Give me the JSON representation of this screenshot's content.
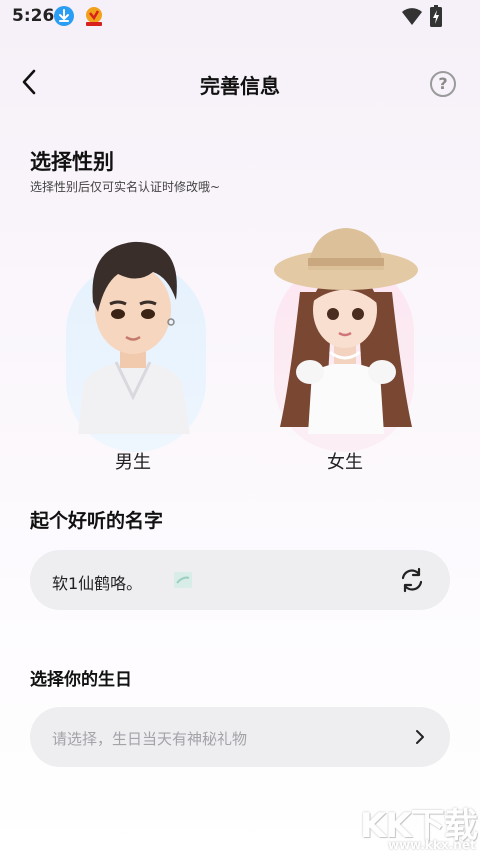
{
  "status_bar": {
    "time": "5:26"
  },
  "nav": {
    "title": "完善信息",
    "help_symbol": "?"
  },
  "gender": {
    "title": "选择性别",
    "hint": "选择性别后仅可实名认证时修改哦~",
    "options": [
      {
        "label": "男生",
        "accent": "#e5f1fd"
      },
      {
        "label": "女生",
        "accent": "#fde6f1"
      }
    ]
  },
  "name": {
    "title": "起个好听的名字",
    "value": "软1仙鹤咯。"
  },
  "birthday": {
    "title": "选择你的生日",
    "placeholder": "请选择，生日当天有神秘礼物"
  },
  "watermark": {
    "logo_text": "KK下载",
    "url": "www.kkx.net"
  },
  "icons": [
    "download-icon",
    "app-icon",
    "wifi-icon",
    "battery-icon",
    "back-arrow-icon",
    "help-icon",
    "refresh-icon",
    "chevron-right-icon"
  ]
}
